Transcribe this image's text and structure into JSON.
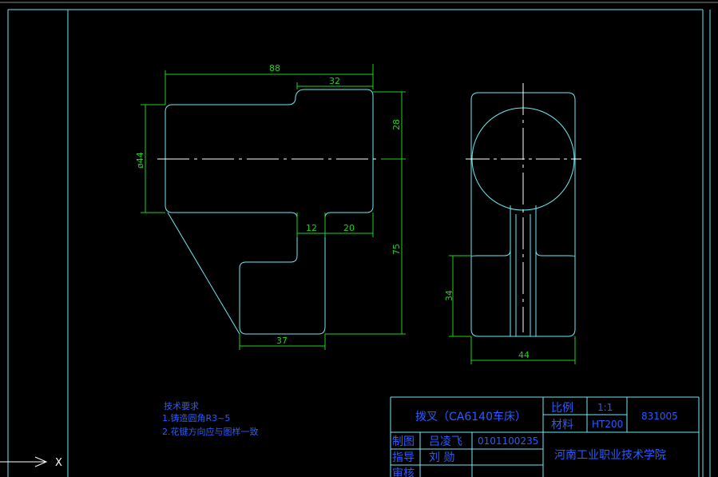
{
  "drawing": {
    "dimensions": {
      "d88": "88",
      "d32": "32",
      "d28": "28",
      "d44dia": "ø44",
      "d12": "12",
      "d20": "20",
      "d75": "75",
      "d37": "37",
      "d34": "34",
      "d44": "44"
    }
  },
  "notes": {
    "title": "技术要求",
    "line1": "1.铸造圆角R3~5",
    "line2": "2.花键方向应与图样一致"
  },
  "title_block": {
    "part_name": "拨叉（CA6140车床）",
    "scale_label": "比例",
    "scale_value": "1:1",
    "material_label": "材料",
    "material_value": "HT200",
    "drawing_no": "831005",
    "drawn_label": "制图",
    "drawn_name": "吕凌飞",
    "drawn_id": "0101100235",
    "guide_label": "指导",
    "guide_name": "刘 勋",
    "review_label": "审核",
    "school": "河南工业职业技术学院"
  },
  "ucs": {
    "x_label": "X"
  },
  "colors": {
    "background": "#000000",
    "outline": "#6fe9f2",
    "dimension": "#1fd21f",
    "text": "#2b5bff",
    "centerline": "#ffffff"
  }
}
